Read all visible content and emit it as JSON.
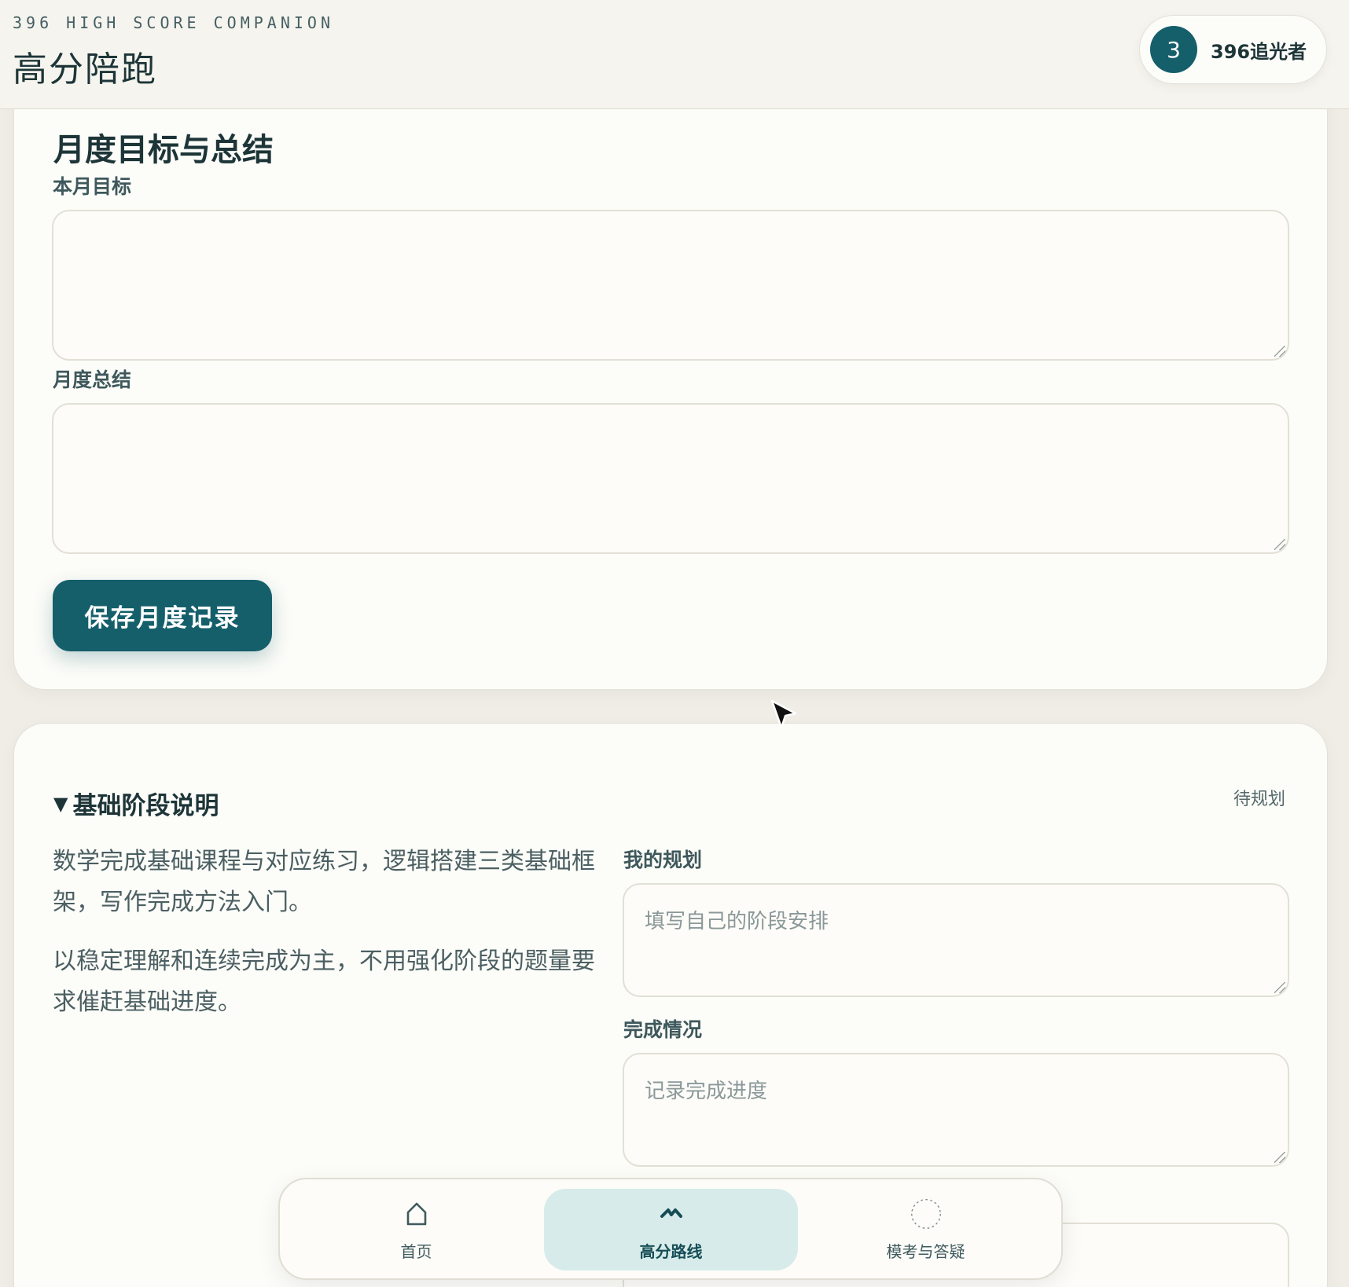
{
  "header": {
    "brand_sub": "396 HIGH SCORE COMPANION",
    "brand_title": "高分陪跑",
    "user": {
      "avatar_text": "3",
      "name": "396追光者"
    }
  },
  "monthly": {
    "title": "月度目标与总结",
    "goal_label": "本月目标",
    "goal_value": "",
    "summary_label": "月度总结",
    "summary_value": "",
    "save_label": "保存月度记录"
  },
  "stage": {
    "title": "基础阶段说明",
    "status": "待规划",
    "desc_1": "数学完成基础课程与对应练习，逻辑搭建三类基础框架，写作完成方法入门。",
    "desc_2": "以稳定理解和连续完成为主，不用强化阶段的题量要求催赶基础进度。",
    "plan_label": "我的规划",
    "plan_placeholder": "填写自己的阶段安排",
    "plan_value": "",
    "progress_label": "完成情况",
    "progress_placeholder": "记录完成进度",
    "progress_value": ""
  },
  "nav": {
    "items": [
      {
        "label": "首页",
        "icon": "home-icon"
      },
      {
        "label": "高分路线",
        "icon": "route-icon",
        "active": true
      },
      {
        "label": "模考与答疑",
        "icon": "dashed-circle-icon"
      }
    ]
  },
  "colors": {
    "accent": "#155f6b",
    "nav_active_bg": "#d7ecea",
    "page_bg": "#efede6",
    "card_bg": "#fcfcf8"
  }
}
